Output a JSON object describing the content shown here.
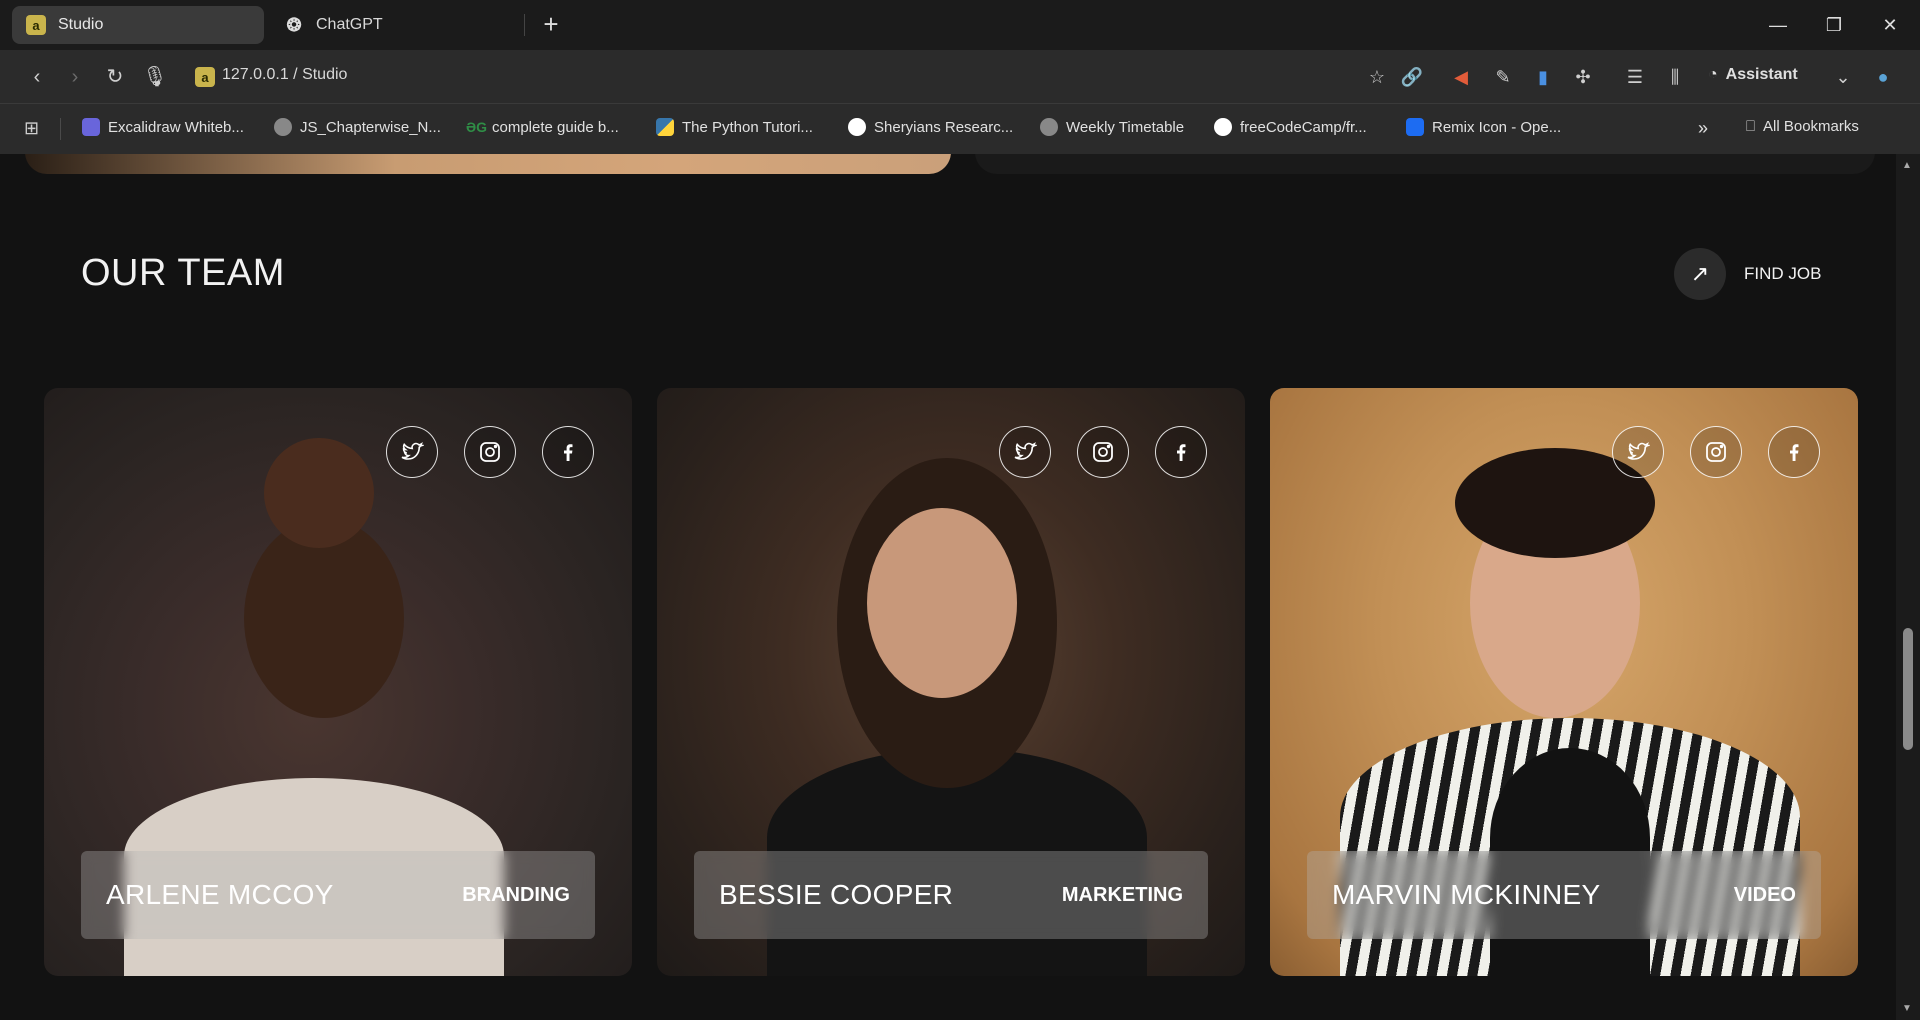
{
  "browser": {
    "tabs": [
      {
        "label": "Studio",
        "favicon": "a"
      },
      {
        "label": "ChatGPT",
        "favicon": "chatgpt-icon"
      }
    ],
    "url": "127.0.0.1 / Studio",
    "url_favicon": "a",
    "assistant_label": "Assistant",
    "bookmarks": [
      {
        "label": "Excalidraw Whiteb...",
        "icon_color": "#6965db"
      },
      {
        "label": "JS_Chapterwise_N...",
        "icon_color": "#888888"
      },
      {
        "label": "complete guide b...",
        "icon_color": "#2f8d46"
      },
      {
        "label": "The Python Tutori...",
        "icon_color": "#3776ab"
      },
      {
        "label": "Sheryians Researc...",
        "icon_color": "#111111"
      },
      {
        "label": "Weekly Timetable",
        "icon_color": "#888888"
      },
      {
        "label": "freeCodeCamp/fr...",
        "icon_color": "#ffffff"
      },
      {
        "label": "Remix Icon - Ope...",
        "icon_color": "#1d6cf2"
      }
    ],
    "all_bookmarks_label": "All Bookmarks"
  },
  "section": {
    "title": "OUR TEAM",
    "find_job_label": "FIND JOB"
  },
  "team": [
    {
      "name": "ARLENE MCCOY",
      "role": "BRANDING"
    },
    {
      "name": "BESSIE COOPER",
      "role": "MARKETING"
    },
    {
      "name": "MARVIN MCKINNEY",
      "role": "VIDEO"
    }
  ],
  "social_icons": [
    "twitter-icon",
    "instagram-icon",
    "facebook-icon"
  ],
  "colors": {
    "page_bg": "#121212",
    "accent_yellow": "#c9b44c"
  }
}
